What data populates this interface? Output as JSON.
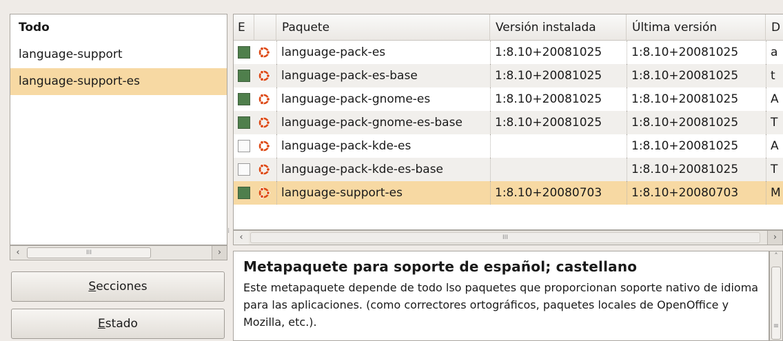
{
  "left": {
    "items": [
      "Todo",
      "language-support",
      "language-support-es"
    ],
    "selected_index": 2
  },
  "buttons": {
    "sections": {
      "first": "S",
      "rest": "ecciones"
    },
    "status": {
      "first": "E",
      "rest": "stado"
    }
  },
  "table": {
    "headers": [
      "E",
      "",
      "Paquete",
      "Versión instalada",
      "Última versión",
      "D"
    ],
    "rows": [
      {
        "checked": true,
        "package": "language-pack-es",
        "installed": "1:8.10+20081025",
        "latest": "1:8.10+20081025",
        "desc": "a"
      },
      {
        "checked": true,
        "package": "language-pack-es-base",
        "installed": "1:8.10+20081025",
        "latest": "1:8.10+20081025",
        "desc": "t"
      },
      {
        "checked": true,
        "package": "language-pack-gnome-es",
        "installed": "1:8.10+20081025",
        "latest": "1:8.10+20081025",
        "desc": "A"
      },
      {
        "checked": true,
        "package": "language-pack-gnome-es-base",
        "installed": "1:8.10+20081025",
        "latest": "1:8.10+20081025",
        "desc": "T"
      },
      {
        "checked": false,
        "package": "language-pack-kde-es",
        "installed": "",
        "latest": "1:8.10+20081025",
        "desc": "A"
      },
      {
        "checked": false,
        "package": "language-pack-kde-es-base",
        "installed": "",
        "latest": "1:8.10+20081025",
        "desc": "T"
      },
      {
        "checked": true,
        "package": "language-support-es",
        "installed": "1:8.10+20080703",
        "latest": "1:8.10+20080703",
        "desc": "M"
      }
    ],
    "selected_row": 6
  },
  "description": {
    "title": "Metapaquete para soporte de español; castellano",
    "body": "Este metapaquete depende de todo lso paquetes que proporcionan soporte nativo de idioma para las aplicaciones. (como correctores ortográficos, paquetes locales de OpenOffice y Mozilla, etc.)."
  },
  "icons": {
    "checkbox": "checkbox-icon",
    "package": "ubuntu-logo-icon",
    "scroll_left": "arrow-left-icon",
    "scroll_right": "arrow-right-icon",
    "scroll_up": "arrow-up-icon"
  },
  "colors": {
    "selection": "#f7d9a3",
    "checked": "#4f7f4c",
    "ubuntu": "#dd4814"
  }
}
